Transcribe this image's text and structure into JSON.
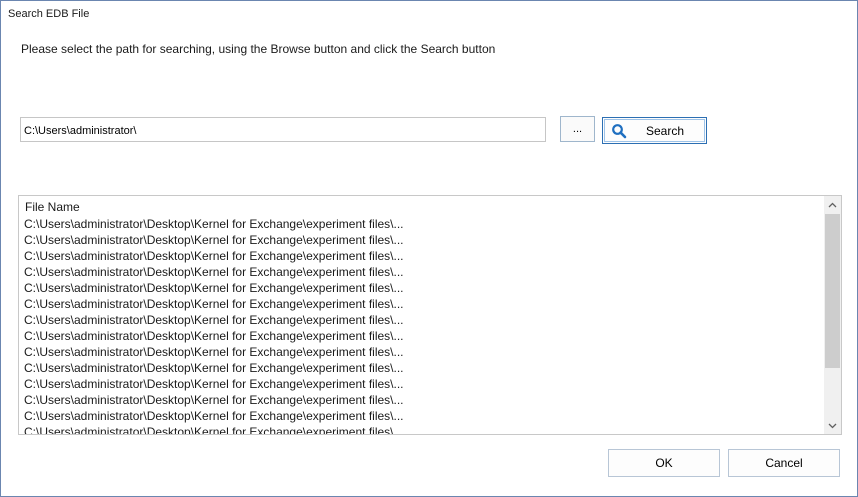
{
  "window": {
    "title": "Search EDB File"
  },
  "instructions": "Please select the path for searching, using the Browse button and click the Search button",
  "path_input": {
    "value": "C:\\Users\\administrator\\"
  },
  "browse_button": {
    "label": "..."
  },
  "search_button": {
    "label": "Search",
    "icon": "search-icon"
  },
  "file_list": {
    "column_header": "File Name",
    "rows": [
      "C:\\Users\\administrator\\Desktop\\Kernel for Exchange\\experiment files\\...",
      "C:\\Users\\administrator\\Desktop\\Kernel for Exchange\\experiment files\\...",
      "C:\\Users\\administrator\\Desktop\\Kernel for Exchange\\experiment files\\...",
      "C:\\Users\\administrator\\Desktop\\Kernel for Exchange\\experiment files\\...",
      "C:\\Users\\administrator\\Desktop\\Kernel for Exchange\\experiment files\\...",
      "C:\\Users\\administrator\\Desktop\\Kernel for Exchange\\experiment files\\...",
      "C:\\Users\\administrator\\Desktop\\Kernel for Exchange\\experiment files\\...",
      "C:\\Users\\administrator\\Desktop\\Kernel for Exchange\\experiment files\\...",
      "C:\\Users\\administrator\\Desktop\\Kernel for Exchange\\experiment files\\...",
      "C:\\Users\\administrator\\Desktop\\Kernel for Exchange\\experiment files\\...",
      "C:\\Users\\administrator\\Desktop\\Kernel for Exchange\\experiment files\\...",
      "C:\\Users\\administrator\\Desktop\\Kernel for Exchange\\experiment files\\...",
      "C:\\Users\\administrator\\Desktop\\Kernel for Exchange\\experiment files\\...",
      "C:\\Users\\administrator\\Desktop\\Kernel for Exchange\\experiment files\\..."
    ]
  },
  "buttons": {
    "ok_label": "OK",
    "cancel_label": "Cancel"
  },
  "colors": {
    "accent": "#2c6fb3",
    "search_icon": "#1f6fc0"
  }
}
